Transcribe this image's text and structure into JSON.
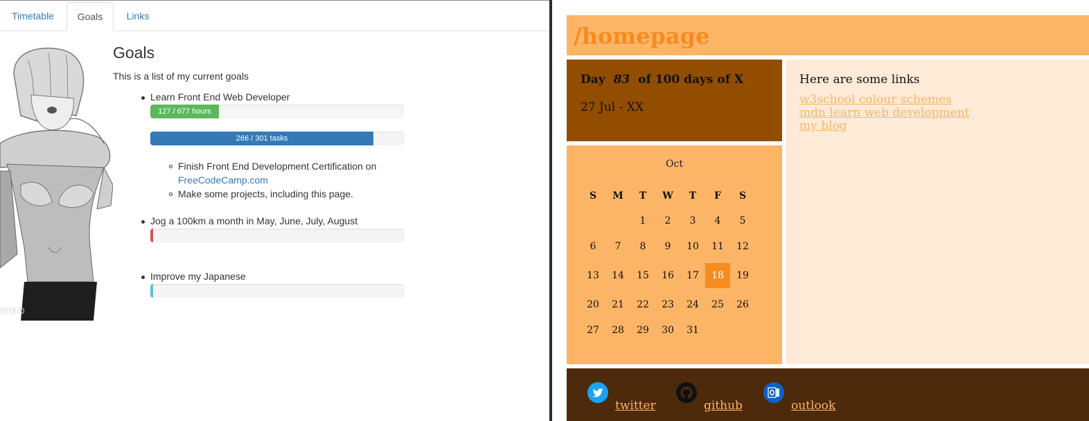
{
  "left": {
    "tabs": [
      "Timetable",
      "Goals",
      "Links"
    ],
    "title": "Goals",
    "description": "This is a list of my current goals",
    "goals": [
      {
        "label": "Learn Front End Web Developer",
        "bars": [
          {
            "text": "127 / 677 hours",
            "progress": 0.27,
            "color": "#5cb85c"
          },
          {
            "text": "266 / 301 tasks",
            "progress": 0.88,
            "color": "#337ab7"
          }
        ],
        "subitems": [
          {
            "text": "Finish Front End Development Certification on",
            "link": "FreeCodeCamp.com"
          },
          {
            "text": "Make some projects, including this page."
          }
        ]
      },
      {
        "label": "Jog a 100km a month in May, June, July, August",
        "bars": [
          {
            "text": "",
            "progress": 0.01,
            "color": "#d9534f"
          }
        ]
      },
      {
        "label": "Improve my Japanese",
        "bars": [
          {
            "text": "",
            "progress": 0.01,
            "color": "#5bc0de"
          }
        ]
      }
    ],
    "image_caption": "姉妹の"
  },
  "right": {
    "title": "/homepage",
    "day": {
      "prefix": "Day",
      "number": "83",
      "suffix": "of 100 days of X",
      "date": "27 Jul - XX"
    },
    "calendar": {
      "month": "Oct",
      "weekdays": [
        "S",
        "M",
        "T",
        "W",
        "T",
        "F",
        "S"
      ],
      "today": "18"
    },
    "links": {
      "title": "Here are some links",
      "items": [
        "w3school colour schemes",
        "mdn learn web development",
        "my blog"
      ]
    },
    "footer": {
      "twitter": "twitter",
      "github": "github",
      "outlook": "outlook"
    },
    "colors": {
      "header": "#fcb466",
      "title": "#f68b1f",
      "day_bg": "#924d00",
      "links_bg": "#fdebd8",
      "footer_bg": "#4d2a0c"
    }
  }
}
